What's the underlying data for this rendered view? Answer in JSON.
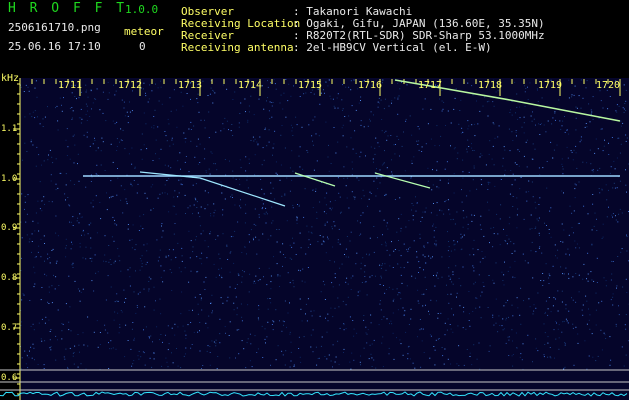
{
  "app": {
    "title": "H R O F F T",
    "version": "1.0.0",
    "filename": "2506161710.png",
    "timestamp": "25.06.16 17:10",
    "meteor_label": "meteor",
    "meteor_count": "0"
  },
  "info": {
    "observer_label": "Observer",
    "observer_value": ": Takanori Kawachi",
    "location_label": "Receiving Location",
    "location_value": ": Ogaki, Gifu, JAPAN (136.60E, 35.35N)",
    "receiver_label": "Receiver",
    "receiver_value": ": R820T2(RTL-SDR) SDR-Sharp 53.1000MHz",
    "antenna_label": "Receiving antenna",
    "antenna_value": ": 2el-HB9CV Vertical (el. E-W)"
  },
  "spectrogram": {
    "y_unit": "kHz",
    "y_ticks": [
      "1.1",
      "1.0",
      "0.9",
      "0.8",
      "0.7",
      "0.6"
    ],
    "x_ticks": [
      "1711",
      "1712",
      "1713",
      "1714",
      "1715",
      "1716",
      "1717",
      "1718",
      "1719",
      "1720"
    ]
  },
  "colors": {
    "header_title": "#1fd81f",
    "labels": "#ffff66",
    "background": "#05052a",
    "signal": "#8ff0ff"
  }
}
